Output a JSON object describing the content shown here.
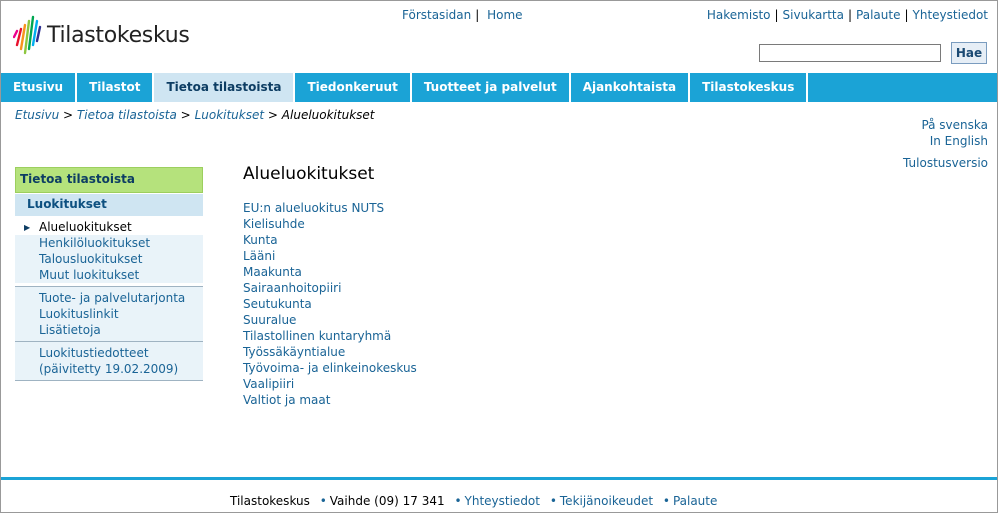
{
  "site": {
    "logo_text": "Tilastokeskus"
  },
  "top_center": {
    "home_sv": "Förstasidan",
    "home_en": "Home"
  },
  "top_right": {
    "items": [
      "Hakemisto",
      "Sivukartta",
      "Palaute",
      "Yhteystiedot"
    ]
  },
  "search": {
    "value": "",
    "button": "Hae"
  },
  "nav": {
    "items": [
      "Etusivu",
      "Tilastot",
      "Tietoa tilastoista",
      "Tiedonkeruut",
      "Tuotteet ja palvelut",
      "Ajankohtaista",
      "Tilastokeskus"
    ],
    "active": "Tietoa tilastoista"
  },
  "breadcrumb": {
    "items": [
      "Etusivu",
      "Tietoa tilastoista",
      "Luokitukset"
    ],
    "current": "Alueluokitukset",
    "separator": ">"
  },
  "lang": {
    "sv": "På svenska",
    "en": "In English"
  },
  "print": "Tulostusversio",
  "leftnav": {
    "heading": "Tietoa tilastoista",
    "sub": "Luokitukset",
    "group1": [
      "Alueluokitukset",
      "Henkilöluokitukset",
      "Talousluokitukset",
      "Muut luokitukset"
    ],
    "group2": [
      "Tuote- ja palvelutarjonta",
      "Luokituslinkit",
      "Lisätietoja"
    ],
    "group3": [
      "Luokitustiedotteet",
      "(päivitetty 19.02.2009)"
    ]
  },
  "main": {
    "title": "Alueluokitukset",
    "links": [
      "EU:n alueluokitus NUTS",
      "Kielisuhde",
      "Kunta",
      "Lääni",
      "Maakunta",
      "Sairaanhoitopiiri",
      "Seutukunta",
      "Suuralue",
      "Tilastollinen kuntaryhmä",
      "Työssäkäyntialue",
      "Työvoima- ja elinkeinokeskus",
      "Vaalipiiri",
      "Valtiot ja maat"
    ]
  },
  "footer": {
    "org": "Tilastokeskus",
    "phone": "Vaihde (09) 17 341",
    "links": [
      "Yhteystiedot",
      "Tekijänoikeudet",
      "Palaute"
    ]
  },
  "colors": {
    "nav_bg": "#1ba3d6",
    "nav_active": "#cfe5f2",
    "link": "#1a6496",
    "green_head": "#b5e27c"
  }
}
